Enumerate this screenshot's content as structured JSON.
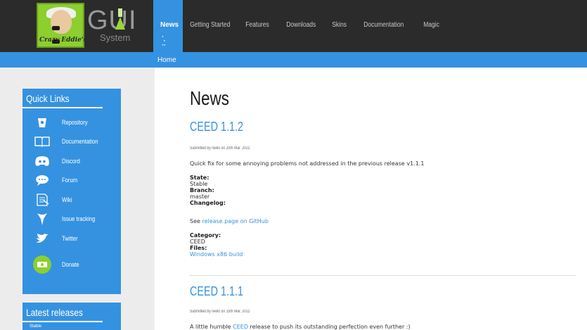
{
  "logo": {
    "crazy_text": "Crazy Eddie's",
    "gui_text": "GUI",
    "system_text": "System"
  },
  "nav": {
    "items": [
      {
        "label": "News"
      },
      {
        "label": "Getting Started"
      },
      {
        "label": "Features"
      },
      {
        "label": "Downloads"
      },
      {
        "label": "Skins"
      },
      {
        "label": "Documentation"
      },
      {
        "label": "Magic"
      }
    ],
    "active_index": 0
  },
  "breadcrumb": {
    "home": "Home"
  },
  "sidebar": {
    "quick_links": {
      "title": "Quick Links",
      "items": [
        {
          "label": "Repository",
          "icon": "bucket-icon"
        },
        {
          "label": "Documentation",
          "icon": "book-icon"
        },
        {
          "label": "Discord",
          "icon": "discord-icon"
        },
        {
          "label": "Forum",
          "icon": "chat-bubble-icon"
        },
        {
          "label": "Wiki",
          "icon": "wiki-page-icon"
        },
        {
          "label": "Issue tracking",
          "icon": "bug-icon"
        },
        {
          "label": "Twitter",
          "icon": "twitter-bird-icon"
        },
        {
          "label": "Donate",
          "icon": "donate-icon"
        }
      ]
    },
    "latest_releases": {
      "title": "Latest releases",
      "first_item": "Stable"
    }
  },
  "main": {
    "page_title": "News",
    "posts": [
      {
        "title": "CEED 1.1.2",
        "submitted": "Submitted by niello on 20th Mar. 2022",
        "summary": "Quick fix for some annoying problems not addressed in the previous release v1.1.1",
        "state_label": "State:",
        "state_value": "Stable",
        "branch_label": "Branch:",
        "branch_value": "master",
        "changelog_label": "Changelog:",
        "changelog_prefix": "See ",
        "changelog_link": "release page on GitHub",
        "category_label": "Category:",
        "category_value": "CEED",
        "files_label": "Files:",
        "files_link": "Windows x86 build"
      },
      {
        "title": "CEED 1.1.1",
        "submitted": "Submitted by niello on 15th Mar. 2022",
        "summary_prefix": "A little humble ",
        "summary_link": "CEED",
        "summary_suffix": " release to push its outstanding perfection even further :)"
      }
    ]
  },
  "colors": {
    "accent": "#3592e0",
    "topbar": "#2b2b2b",
    "logo_green": "#8ccf2e"
  }
}
